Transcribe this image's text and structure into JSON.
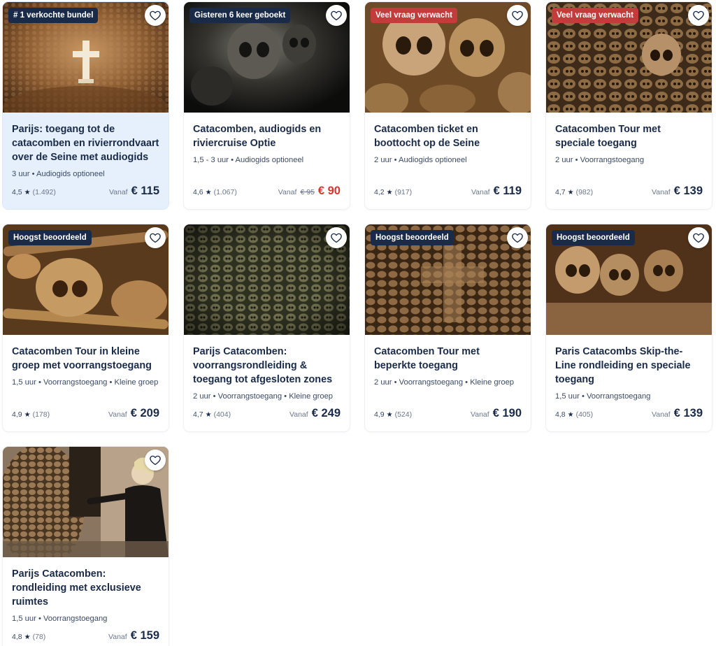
{
  "cards": [
    {
      "badge": "# 1 verkochte bundel",
      "badge_color": "navy",
      "title": "Parijs: toegang tot de catacomben en rivierrondvaart over de Seine met audiogids",
      "meta": "3 uur • Audiogids optioneel",
      "rating": "4,5",
      "count": "(1.492)",
      "vanaf": "Vanaf",
      "old_price": "",
      "price": "€ 115",
      "price_color": "normal",
      "highlight": true,
      "image": "cross-in-bone-wall-icon"
    },
    {
      "badge": "Gisteren 6 keer geboekt",
      "badge_color": "navy",
      "title": "Catacomben, audiogids en riviercruise Optie",
      "meta": "1,5 - 3 uur • Audiogids optioneel",
      "rating": "4,6",
      "count": "(1.067)",
      "vanaf": "Vanaf",
      "old_price": "€ 95",
      "price": "€ 90",
      "price_color": "red",
      "highlight": false,
      "image": "dark-skulls-icon"
    },
    {
      "badge": "Veel vraag verwacht",
      "badge_color": "red",
      "title": "Catacomben ticket en boottocht op de Seine",
      "meta": "2 uur • Audiogids optioneel",
      "rating": "4,2",
      "count": "(917)",
      "vanaf": "Vanaf",
      "old_price": "",
      "price": "€ 119",
      "price_color": "normal",
      "highlight": false,
      "image": "skulls-closeup-icon"
    },
    {
      "badge": "Veel vraag verwacht",
      "badge_color": "red",
      "title": "Catacomben Tour met speciale toegang",
      "meta": "2 uur • Voorrangstoegang",
      "rating": "4,7",
      "count": "(982)",
      "vanaf": "Vanaf",
      "old_price": "",
      "price": "€ 139",
      "price_color": "normal",
      "highlight": false,
      "image": "skull-wall-icon"
    },
    {
      "badge": "Hoogst beoordeeld",
      "badge_color": "navy",
      "title": "Catacomben Tour in kleine groep met voorrangstoegang",
      "meta": "1,5 uur • Voorrangstoegang • Kleine groep",
      "rating": "4,9",
      "count": "(178)",
      "vanaf": "Vanaf",
      "old_price": "",
      "price": "€ 209",
      "price_color": "normal",
      "highlight": false,
      "image": "bones-pile-icon"
    },
    {
      "badge": "",
      "badge_color": "navy",
      "title": "Parijs Catacomben: voorrangsrondleiding & toegang tot afgesloten zones",
      "meta": "2 uur • Voorrangstoegang • Kleine groep",
      "rating": "4,7",
      "count": "(404)",
      "vanaf": "Vanaf",
      "old_price": "",
      "price": "€ 249",
      "price_color": "normal",
      "highlight": false,
      "image": "green-skull-wall-icon"
    },
    {
      "badge": "Hoogst beoordeeld",
      "badge_color": "navy",
      "title": "Catacomben Tour met beperkte toegang",
      "meta": "2 uur • Voorrangstoegang • Kleine groep",
      "rating": "4,9",
      "count": "(524)",
      "vanaf": "Vanaf",
      "old_price": "",
      "price": "€ 190",
      "price_color": "normal",
      "highlight": false,
      "image": "skull-cross-pattern-icon"
    },
    {
      "badge": "Hoogst beoordeeld",
      "badge_color": "navy",
      "title": "Paris Catacombs Skip-the-Line rondleiding en speciale toegang",
      "meta": "1,5 uur • Voorrangstoegang",
      "rating": "4,8",
      "count": "(405)",
      "vanaf": "Vanaf",
      "old_price": "",
      "price": "€ 139",
      "price_color": "normal",
      "highlight": false,
      "image": "skull-row-icon"
    },
    {
      "badge": "",
      "badge_color": "navy",
      "title": "Parijs Catacomben: rondleiding met exclusieve ruimtes",
      "meta": "1,5 uur • Voorrangstoegang",
      "rating": "4,8",
      "count": "(78)",
      "vanaf": "Vanaf",
      "old_price": "",
      "price": "€ 159",
      "price_color": "normal",
      "highlight": false,
      "image": "guide-pointing-icon"
    }
  ],
  "colors": {
    "navy": "#1a2b49",
    "red_badge": "#c23c3c",
    "red_price": "#d2362f",
    "highlight_bg": "#e6f0fd"
  }
}
